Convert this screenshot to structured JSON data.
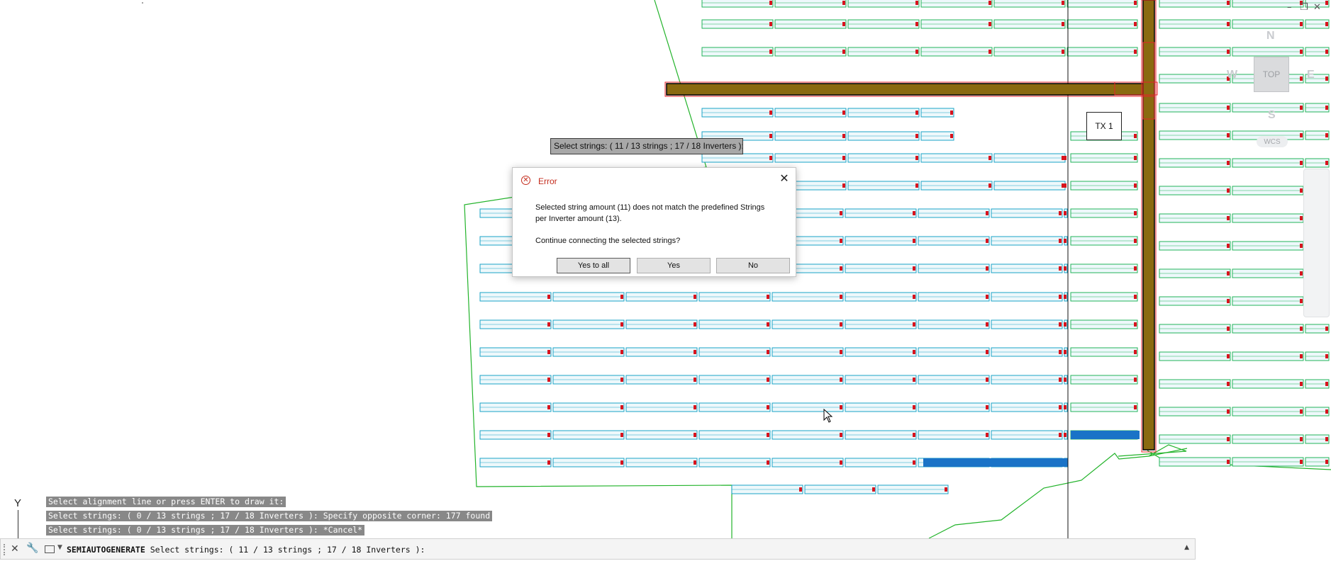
{
  "window_controls": {
    "minimize": "–",
    "restore": "❐",
    "close": "✕"
  },
  "viewcube": {
    "north": "N",
    "south": "S",
    "east": "E",
    "west": "W",
    "top": "TOP",
    "wcs": "WCS"
  },
  "drawing": {
    "transformer_label": "TX 1",
    "colors": {
      "background": "#ffffff",
      "table_cyan": "#1aa3c7",
      "table_green": "#21b35a",
      "table_selected": "#1a73c7",
      "road_fill": "#8a6a10",
      "road_edge": "#000000",
      "boundary": "#22b32a",
      "highlight_red": "#e8232a",
      "inverter_red": "#d8141e"
    }
  },
  "tooltip": {
    "text": "Select strings: ( 11 / 13 strings ; 17 / 18 Inverters ):"
  },
  "dialog": {
    "title": "Error",
    "icon": "error-circle-icon",
    "message": "Selected string amount (11) does not match the predefined Strings per Inverter amount (13).",
    "question": "Continue connecting the selected strings?",
    "buttons": {
      "yes_to_all": "Yes to all",
      "yes": "Yes",
      "no": "No"
    },
    "close": "✕"
  },
  "command_history": [
    "Select alignment line or press ENTER to draw it:",
    "Select strings: ( 0 / 13 strings ; 17 / 18 Inverters ): Specify opposite corner: 177 found",
    "Select strings: ( 0 / 13 strings ; 17 / 18 Inverters ): *Cancel*"
  ],
  "ucs_axis": {
    "y_label": "Y"
  },
  "command_line": {
    "close": "✕",
    "settings_icon": "wrench-icon",
    "command_name": "SEMIAUTOGENERATE",
    "prompt": "Select strings: ( 11 / 13 strings ; 17 / 18 Inverters ):",
    "expand": "▲",
    "dropdown": "▼"
  }
}
